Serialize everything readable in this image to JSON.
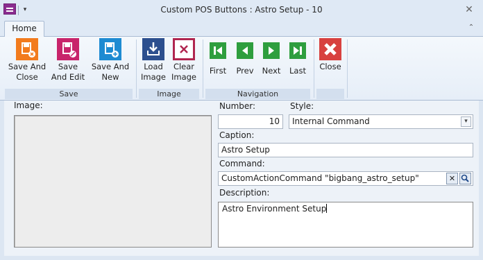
{
  "window": {
    "title": "Custom POS Buttons : Astro Setup - 10"
  },
  "tabs": [
    {
      "label": "Home"
    }
  ],
  "ribbon": {
    "groups": {
      "save": {
        "label": "Save",
        "buttons": [
          {
            "line1": "Save And",
            "line2": "Close",
            "icon": "save-close-icon"
          },
          {
            "line1": "Save",
            "line2": "And Edit",
            "icon": "save-edit-icon"
          },
          {
            "line1": "Save And",
            "line2": "New",
            "icon": "save-new-icon"
          }
        ]
      },
      "image": {
        "label": "Image",
        "buttons": [
          {
            "line1": "Load",
            "line2": "Image",
            "icon": "download-icon"
          },
          {
            "line1": "Clear",
            "line2": "Image",
            "icon": "clear-image-icon"
          }
        ]
      },
      "navigation": {
        "label": "Navigation",
        "buttons": [
          {
            "line1": "First",
            "icon": "first-icon"
          },
          {
            "line1": "Prev",
            "icon": "prev-icon"
          },
          {
            "line1": "Next",
            "icon": "next-icon"
          },
          {
            "line1": "Last",
            "icon": "last-icon"
          }
        ]
      },
      "close": {
        "label": "",
        "buttons": [
          {
            "line1": "Close",
            "icon": "close-red-icon"
          }
        ]
      }
    }
  },
  "form": {
    "image_label": "Image:",
    "number": {
      "label": "Number:",
      "value": "10"
    },
    "style": {
      "label": "Style:",
      "value": "Internal Command"
    },
    "caption": {
      "label": "Caption:",
      "value": "Astro Setup"
    },
    "command": {
      "label": "Command:",
      "value": "CustomActionCommand \"bigbang_astro_setup\""
    },
    "description": {
      "label": "Description:",
      "value": "Astro Environment Setup"
    }
  }
}
